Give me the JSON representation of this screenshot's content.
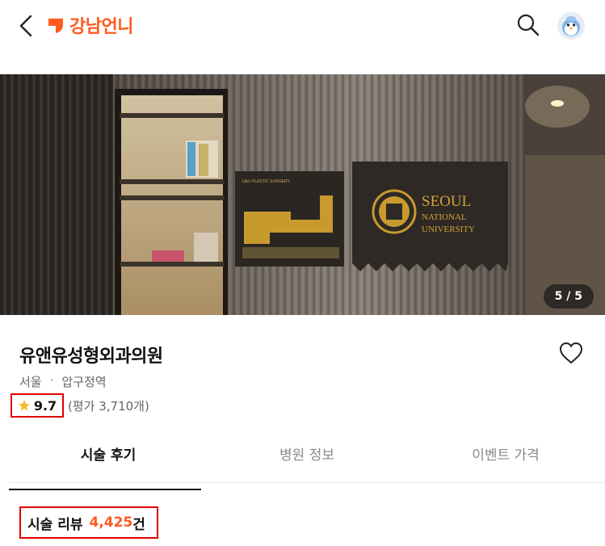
{
  "header": {
    "app_name": "강남언니",
    "brand_color": "#ff5a1f"
  },
  "hero": {
    "photo_counter": "5/5",
    "photo_position": "5 / 5",
    "sign_text": {
      "line1": "SEOUL",
      "line2": "NATIONAL",
      "line3": "UNIVERSITY",
      "floor_sign_title": "U&U PLASTIC SURGERY"
    }
  },
  "clinic": {
    "name": "유앤유성형외과의원",
    "region": "서울",
    "station": "압구정역",
    "rating": "9.7",
    "rating_count_text": "(평가 3,710개)"
  },
  "tabs": [
    {
      "label": "시술 후기",
      "active": true
    },
    {
      "label": "병원 정보",
      "active": false
    },
    {
      "label": "이벤트 가격",
      "active": false
    }
  ],
  "reviews": {
    "label": "시술 리뷰",
    "count": "4,425",
    "unit": "건"
  },
  "colors": {
    "accent": "#ff5a1f",
    "highlight_border": "#e00000",
    "star": "#f5b82e"
  }
}
